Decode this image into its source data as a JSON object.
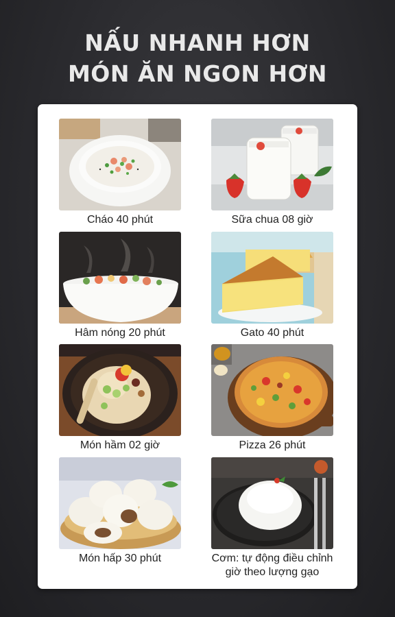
{
  "headline": {
    "line1": "NẤU NHANH HƠN",
    "line2": "MÓN ĂN NGON HƠN"
  },
  "items": [
    {
      "caption": "Cháo 40 phút",
      "image": "rice-porridge"
    },
    {
      "caption": "Sữa chua 08 giờ",
      "image": "yogurt-jars"
    },
    {
      "caption": "Hâm nóng 20 phút",
      "image": "steaming-bowl"
    },
    {
      "caption": "Gato 40 phút",
      "image": "sponge-cake"
    },
    {
      "caption": "Món hầm 02 giờ",
      "image": "stewed-chicken"
    },
    {
      "caption": "Pizza 26 phút",
      "image": "pizza"
    },
    {
      "caption": "Món hấp 30 phút",
      "image": "steamed-buns"
    },
    {
      "caption": "Cơm: tự động điều chỉnh giờ theo lượng gạo",
      "image": "rice-plate"
    }
  ],
  "colors": {
    "background": "#2a2a2e",
    "headline": "#e9e9e9",
    "card": "#ffffff",
    "caption": "#222222"
  }
}
